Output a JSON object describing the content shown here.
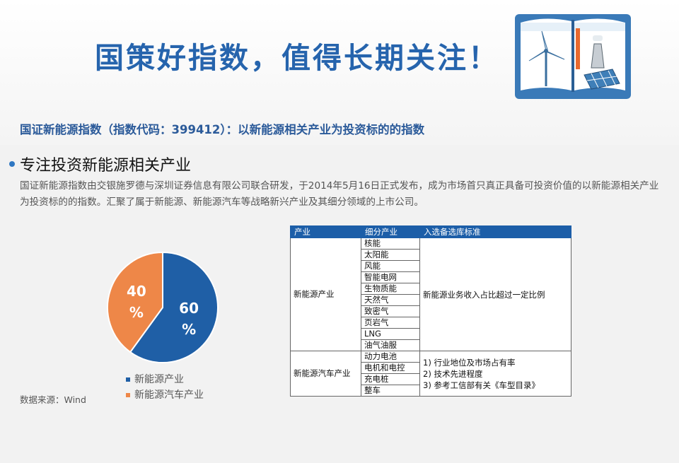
{
  "header": {
    "title": "国策好指数，值得长期关注！",
    "subtitle": "国证新能源指数（指数代码：399412）：以新能源相关产业为投资标的的指数"
  },
  "section": {
    "title": "专注投资新能源相关产业",
    "body": "国证新能源指数由交银施罗德与深圳证券信息有限公司联合研发，于2014年5月16日正式发布，成为市场首只真正具备可投资价值的以新能源相关产业为投资标的的指数。汇聚了属于新能源、新能源汽车等战略新兴产业及其细分领域的上市公司。"
  },
  "chart_data": {
    "type": "pie",
    "slices": [
      {
        "name": "新能源产业",
        "value": 60,
        "label": "60\n%",
        "color": "#1f5fa6"
      },
      {
        "name": "新能源汽车产业",
        "value": 40,
        "label": "40\n%",
        "color": "#ee8748"
      }
    ],
    "legend": [
      "新能源产业",
      "新能源汽车产业"
    ],
    "legend_position": "bottom"
  },
  "source": "数据来源：Wind",
  "table": {
    "headers": [
      "产业",
      "细分产业",
      "入选备选库标准"
    ],
    "groups": [
      {
        "industry": "新能源产业",
        "sub": [
          "核能",
          "太阳能",
          "风能",
          "智能电网",
          "生物质能",
          "天然气",
          "致密气",
          "页岩气",
          "LNG",
          "油气油服"
        ],
        "criteria": [
          "新能源业务收入占比超过一定比例"
        ]
      },
      {
        "industry": "新能源汽车产业",
        "sub": [
          "动力电池",
          "电机和电控",
          "充电桩",
          "整车"
        ],
        "criteria": [
          "1)    行业地位及市场占有率",
          "2)    技术先进程度",
          "3)    参考工信部有关《车型目录》"
        ]
      }
    ]
  },
  "colors": {
    "title": "#2664ad",
    "subtitle": "#2c5b9a",
    "table_header": "#1c5ea8"
  },
  "icons": [
    "book-renewable-energy-icon"
  ]
}
